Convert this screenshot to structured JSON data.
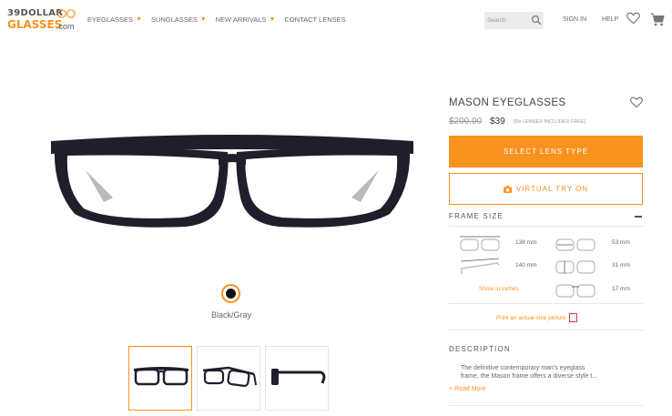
{
  "header": {
    "logo_top": "39DOLLAR",
    "logo_main": "GLASSES",
    "logo_suffix": ".com",
    "nav": [
      {
        "label": "EYEGLASSES",
        "caret": "▼"
      },
      {
        "label": "SUNGLASSES",
        "caret": "▼"
      },
      {
        "label": "NEW ARRIVALS",
        "caret": "▼"
      },
      {
        "label": "CONTACT LENSES",
        "caret": ""
      }
    ],
    "search_placeholder": "Search",
    "sign_in": "SIGN IN",
    "help": "HELP"
  },
  "gallery": {
    "color_name": "Black/Gray",
    "swatch_color": "#111111"
  },
  "product": {
    "title": "MASON EYEGLASSES",
    "old_price": "$200.00",
    "price": "$39",
    "rx_note": "(Rx LENSES INCLUDED FREE)",
    "select_lens_label": "SELECT LENS TYPE",
    "try_on_label": "VIRTUAL TRY ON",
    "frame_size_heading": "FRAME SIZE",
    "measurements": {
      "total_width": "138 mm",
      "lens_width": "53 mm",
      "temple_length": "140 mm",
      "lens_height": "31 mm",
      "bridge": "17 mm"
    },
    "show_inches": "Show in inches",
    "print_label": "Print an actual-size picture",
    "description_heading": "DESCRIPTION",
    "description_line1": "The definitive contemporary man's eyeglass",
    "description_line2": "frame, the Mason frame offers a diverse style t...",
    "read_more": "+ Read More"
  },
  "colors": {
    "accent": "#f7931e",
    "frame": "#1e1f2b"
  }
}
